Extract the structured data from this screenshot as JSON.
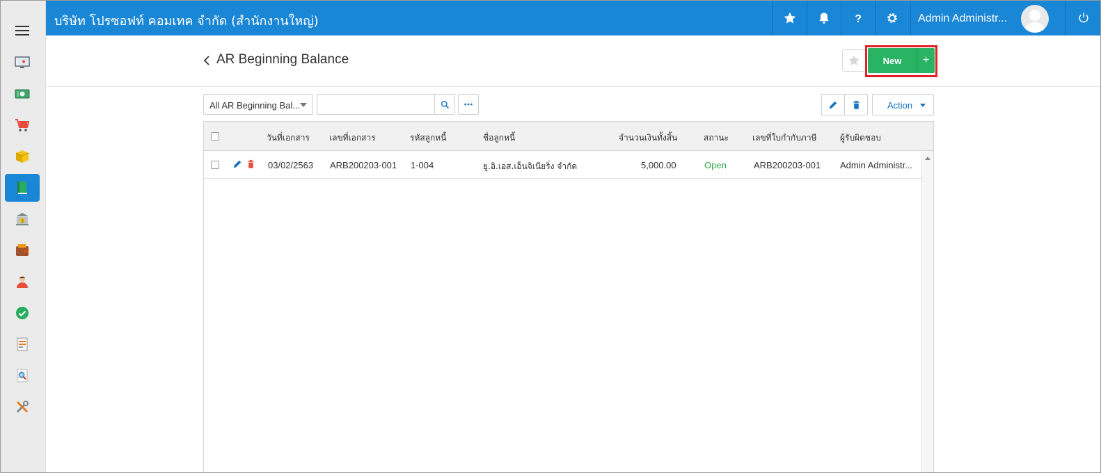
{
  "topbar": {
    "company": "บริษัท โปรซอฟท์ คอมเทค จำกัด (สำนักงานใหญ่)",
    "user_name": "Admin Administr...",
    "icons": [
      "star-icon",
      "bell-icon",
      "help-icon",
      "gear-icon",
      "avatar",
      "power-icon"
    ]
  },
  "sidebar": {
    "items": [
      {
        "name": "dashboard",
        "icon": "monitor-icon",
        "active": false
      },
      {
        "name": "cash",
        "icon": "money-icon",
        "active": false
      },
      {
        "name": "sales",
        "icon": "cart-icon",
        "active": false
      },
      {
        "name": "inventory",
        "icon": "box-icon",
        "active": false
      },
      {
        "name": "accounting",
        "icon": "book-icon",
        "active": true
      },
      {
        "name": "bank",
        "icon": "bank-icon",
        "active": false
      },
      {
        "name": "wallet",
        "icon": "wallet-icon",
        "active": false
      },
      {
        "name": "hr",
        "icon": "person-icon",
        "active": false
      },
      {
        "name": "approve",
        "icon": "check-icon",
        "active": false
      },
      {
        "name": "reports",
        "icon": "report-icon",
        "active": false
      },
      {
        "name": "inquiry",
        "icon": "magnifier-doc-icon",
        "active": false
      },
      {
        "name": "tools",
        "icon": "tools-icon",
        "active": false
      }
    ]
  },
  "page": {
    "title": "AR Beginning Balance",
    "new_label": "New",
    "plus_label": "+"
  },
  "toolbar": {
    "filter_value": "All AR Beginning Bal...",
    "search_placeholder": "",
    "action_label": "Action"
  },
  "table": {
    "columns": [
      "วันที่เอกสาร",
      "เลขที่เอกสาร",
      "รหัสลูกหนี้",
      "ชื่อลูกหนี้",
      "จำนวนเงินทั้งสิ้น",
      "สถานะ",
      "เลขที่ใบกำกับภาษี",
      "ผู้รับผิดชอบ"
    ],
    "rows": [
      {
        "doc_date": "03/02/2563",
        "doc_no": "ARB200203-001",
        "customer_code": "1-004",
        "customer_name": "ยู.อิ.เอส.เอ็นจิเนียริ่ง จำกัด",
        "total": "5,000.00",
        "status": "Open",
        "tax_invoice_no": "ARB200203-001",
        "responsible": "Admin Administr..."
      }
    ]
  },
  "colors": {
    "primary": "#1a86d6",
    "new_button": "#28b463",
    "highlight": "#e22028",
    "status_open": "#28a745",
    "delete": "#e74c3c"
  }
}
